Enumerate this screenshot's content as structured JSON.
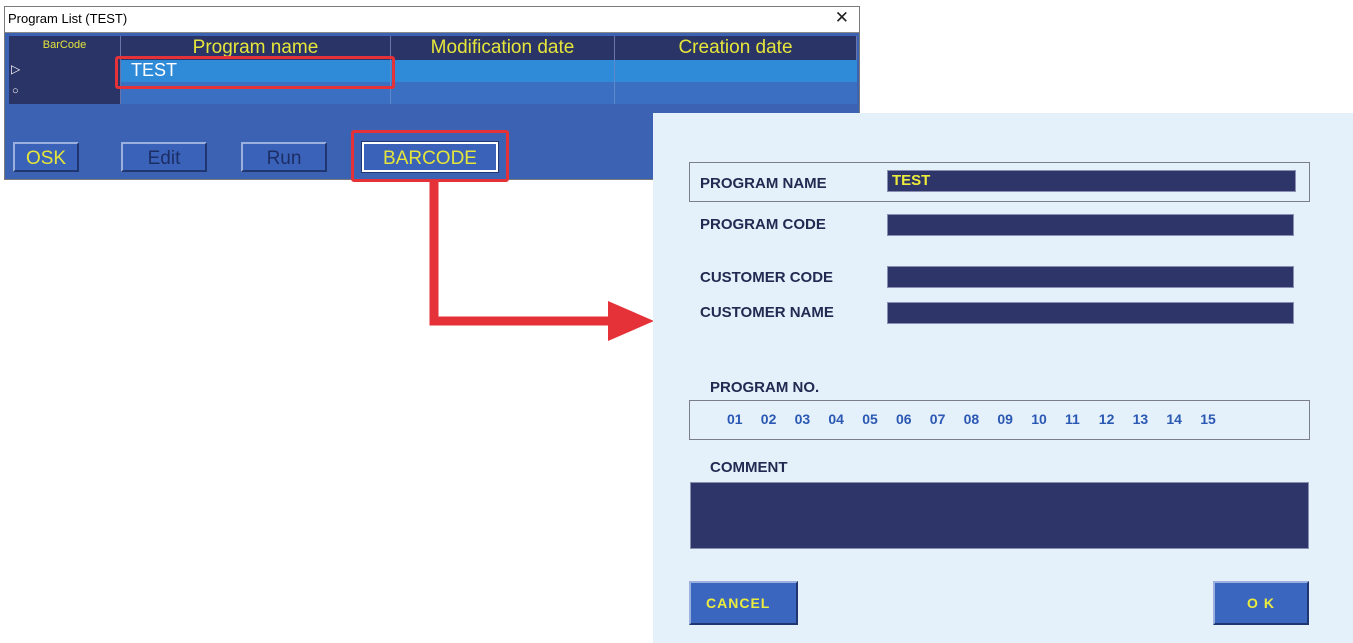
{
  "program_list": {
    "title": "Program List  (TEST)",
    "close_glyph": "✕",
    "columns": {
      "barcode": "BarCode",
      "name": "Program name",
      "modified": "Modification date",
      "created": "Creation date"
    },
    "rows": [
      {
        "marker": "▷",
        "name": "TEST",
        "modified": "",
        "created": ""
      },
      {
        "marker": "○",
        "name": "",
        "modified": "",
        "created": ""
      }
    ],
    "buttons": {
      "osk": "OSK",
      "edit": "Edit",
      "run": "Run",
      "barcode": "BARCODE"
    }
  },
  "dialog": {
    "program_name_label": "PROGRAM NAME",
    "program_name_value": "TEST",
    "program_code_label": "PROGRAM CODE",
    "program_code_value": "",
    "customer_code_label": "CUSTOMER CODE",
    "customer_code_value": "",
    "customer_name_label": "CUSTOMER NAME",
    "customer_name_value": "",
    "program_no_label": "PROGRAM NO.",
    "program_numbers": [
      "01",
      "02",
      "03",
      "04",
      "05",
      "06",
      "07",
      "08",
      "09",
      "10",
      "11",
      "12",
      "13",
      "14",
      "15"
    ],
    "comment_label": "COMMENT",
    "comment_value": "",
    "cancel_label": "CANCEL",
    "ok_label": "O K"
  },
  "colors": {
    "accent": "#e53238",
    "panel": "#3b62b3",
    "field": "#2e3568",
    "text_yellow": "#e6e63a"
  }
}
